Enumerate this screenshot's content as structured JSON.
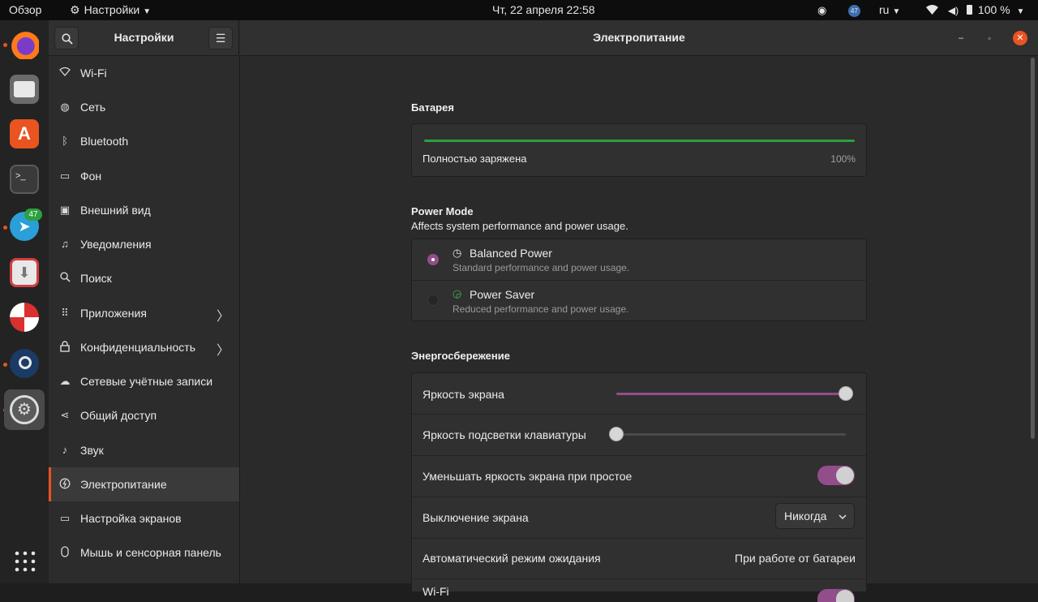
{
  "topbar": {
    "activities": "Обзор",
    "app_menu": "Настройки",
    "clock": "Чт, 22 апреля  22:58",
    "notif_count": "47",
    "lang": "ru",
    "battery": "100 %"
  },
  "dock": {
    "telegram_badge": "47"
  },
  "sidebar": {
    "title": "Настройки",
    "items": [
      {
        "label": "Wi-Fi",
        "icon": "wifi-icon"
      },
      {
        "label": "Сеть",
        "icon": "network-icon"
      },
      {
        "label": "Bluetooth",
        "icon": "bluetooth-icon"
      },
      {
        "label": "Фон",
        "icon": "background-icon"
      },
      {
        "label": "Внешний вид",
        "icon": "appearance-icon"
      },
      {
        "label": "Уведомления",
        "icon": "bell-icon"
      },
      {
        "label": "Поиск",
        "icon": "search-icon"
      },
      {
        "label": "Приложения",
        "icon": "apps-icon"
      },
      {
        "label": "Конфиденциальность",
        "icon": "lock-icon"
      },
      {
        "label": "Сетевые учётные записи",
        "icon": "cloud-icon"
      },
      {
        "label": "Общий доступ",
        "icon": "share-icon"
      },
      {
        "label": "Звук",
        "icon": "music-icon"
      },
      {
        "label": "Электропитание",
        "icon": "power-icon"
      },
      {
        "label": "Настройка экранов",
        "icon": "display-icon"
      },
      {
        "label": "Мышь и сенсорная панель",
        "icon": "mouse-icon"
      }
    ]
  },
  "main": {
    "title": "Электропитание",
    "battery": {
      "heading": "Батарея",
      "status": "Полностью заряжена",
      "percent": "100%",
      "level": 1.0
    },
    "power_mode": {
      "heading": "Power Mode",
      "description": "Affects system performance and power usage.",
      "options": [
        {
          "label": "Balanced Power",
          "desc": "Standard performance and power usage.",
          "selected": true
        },
        {
          "label": "Power Saver",
          "desc": "Reduced performance and power usage.",
          "selected": false
        }
      ]
    },
    "saving": {
      "heading": "Энергосбережение",
      "screen_brightness": {
        "label": "Яркость экрана",
        "level": 1.0
      },
      "kbd_brightness": {
        "label": "Яркость подсветки клавиатуры",
        "level": 0.0
      },
      "dim_idle": {
        "label": "Уменьшать яркость экрана при простое",
        "on": true
      },
      "screen_blank": {
        "label": "Выключение экрана",
        "value": "Никогда"
      },
      "auto_suspend": {
        "label": "Автоматический режим ожидания",
        "value": "При работе от батареи"
      },
      "wifi": {
        "label": "Wi-Fi",
        "on": true
      }
    }
  },
  "colors": {
    "accent": "#924d8b",
    "orange": "#e95420",
    "battery": "#2ea03f"
  }
}
